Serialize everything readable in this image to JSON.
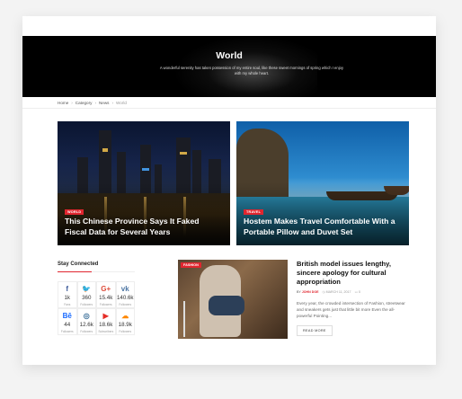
{
  "hero": {
    "title": "World",
    "description": "A wonderful serenity has taken possession of my entire soul, like these sweet mornings of spring which I enjoy with my whole heart."
  },
  "breadcrumb": [
    "Home",
    "Category",
    "News",
    "World"
  ],
  "featured": [
    {
      "category": "WORLD",
      "title": "This Chinese Province Says It Faked Fiscal Data for Several Years"
    },
    {
      "category": "TRAVEL",
      "title": "Hostem Makes Travel Comfortable With a Portable Pillow and Duvet Set"
    }
  ],
  "stay_connected": {
    "heading": "Stay Connected",
    "items": [
      {
        "icon": "facebook-icon",
        "glyph": "f",
        "count": "1k",
        "label": "Fans",
        "color": "#3b5998"
      },
      {
        "icon": "twitter-icon",
        "glyph": "🐦",
        "count": "360",
        "label": "Followers",
        "color": "#1da1f2"
      },
      {
        "icon": "googleplus-icon",
        "glyph": "G+",
        "count": "15.4k",
        "label": "Followers",
        "color": "#dd4b39"
      },
      {
        "icon": "vk-icon",
        "glyph": "vk",
        "count": "140.6k",
        "label": "Followers",
        "color": "#4c75a3"
      },
      {
        "icon": "behance-icon",
        "glyph": "Bē",
        "count": "44",
        "label": "Followers",
        "color": "#1769ff"
      },
      {
        "icon": "instagram-icon",
        "glyph": "◎",
        "count": "12.6k",
        "label": "Followers",
        "color": "#3f729b"
      },
      {
        "icon": "youtube-icon",
        "glyph": "▶",
        "count": "18.6k",
        "label": "Subscribers",
        "color": "#e52d27"
      },
      {
        "icon": "soundcloud-icon",
        "glyph": "☁",
        "count": "18.9k",
        "label": "Followers",
        "color": "#ff8800"
      }
    ]
  },
  "article": {
    "category": "FASHION",
    "title": "British model issues lengthy, sincere apology for cultural appropriation",
    "by": "BY",
    "author": "JOHN DOE",
    "date": "MARCH 11, 2017",
    "comments": "0",
    "excerpt": "Every year, the crowded intersection of Fashion, streetwear and sneakers gets just that little bit more Even the all-powerful Pointing...",
    "read_more": "READ MORE"
  },
  "colors": {
    "accent": "#e0262f"
  }
}
